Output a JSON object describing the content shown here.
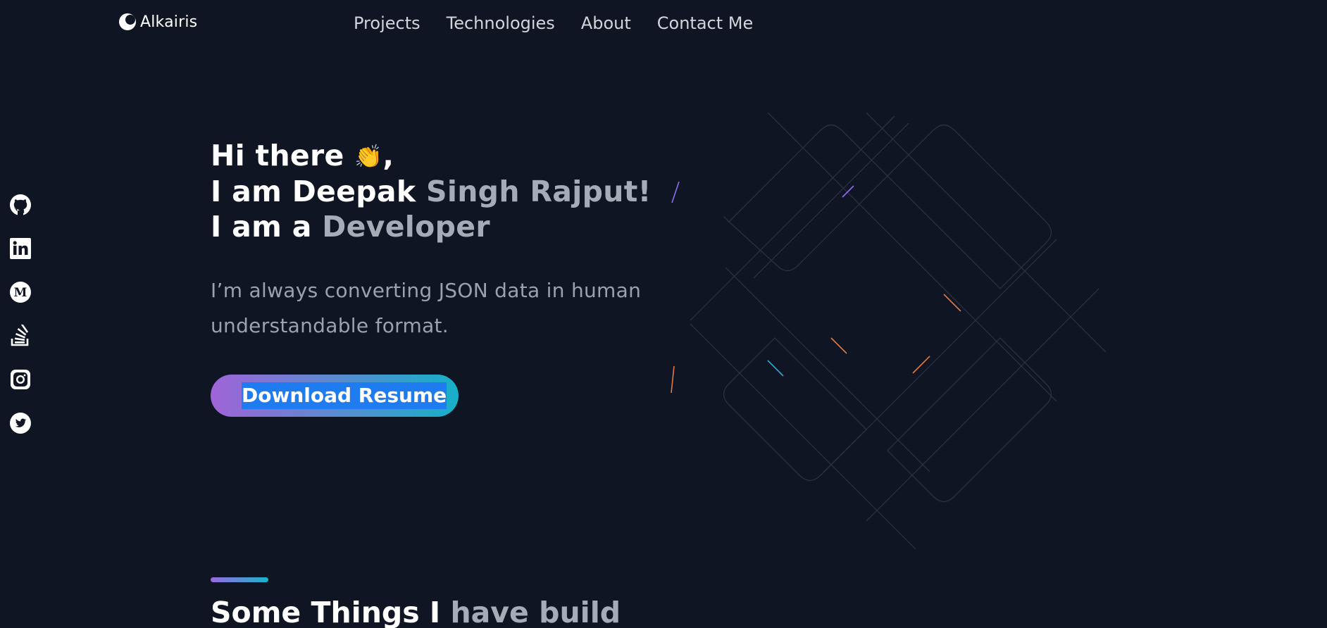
{
  "brand": {
    "name": "Alkairis",
    "icon": "crescent-logo-icon"
  },
  "nav": {
    "items": [
      {
        "label": "Projects"
      },
      {
        "label": "Technologies"
      },
      {
        "label": "About"
      },
      {
        "label": "Contact Me"
      }
    ]
  },
  "social": [
    {
      "name": "github-icon"
    },
    {
      "name": "linkedin-icon"
    },
    {
      "name": "medium-icon"
    },
    {
      "name": "stackoverflow-icon"
    },
    {
      "name": "instagram-icon"
    },
    {
      "name": "twitter-icon"
    }
  ],
  "hero": {
    "line1": "Hi there",
    "wave": "👏",
    "comma": ",",
    "line2_a": "I am ",
    "line2_b": "Deepak",
    "line2_c": " Singh Rajput!",
    "line3_a": "I am a ",
    "line3_b": "Developer",
    "description": "I’m always converting JSON data in human understandable format.",
    "button": "Download Resume"
  },
  "section": {
    "title_a": "Some Things I ",
    "title_b": "have build"
  },
  "colors": {
    "background": "#0f1522",
    "gradient_start": "#a064d8",
    "gradient_end": "#16b0c8",
    "text_muted": "#a6acb7"
  }
}
